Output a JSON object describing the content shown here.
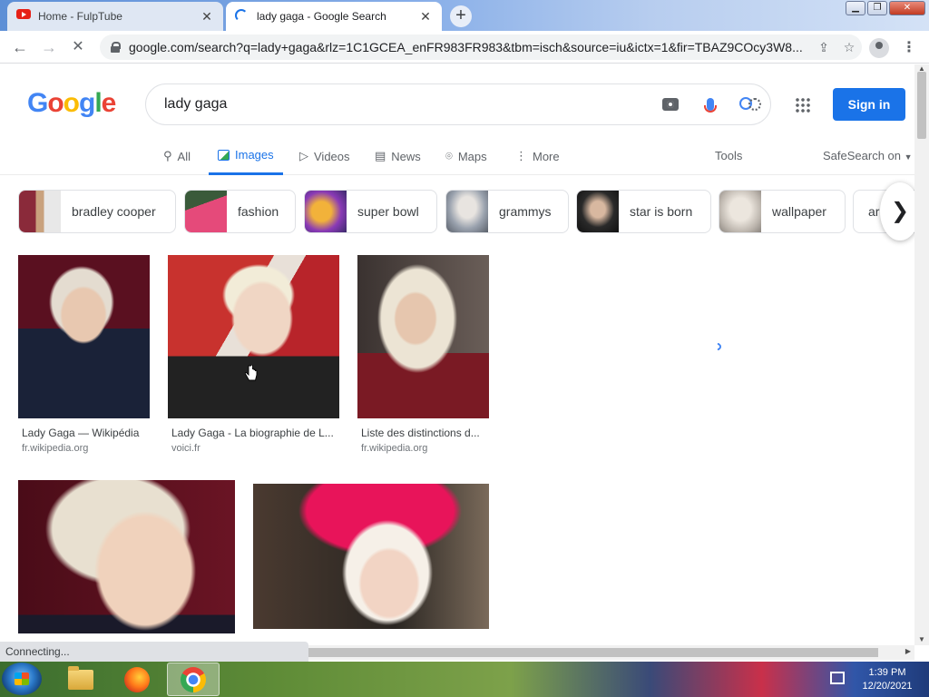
{
  "browser": {
    "tabs": [
      {
        "title": "Home - FulpTube",
        "favicon": "youtube-icon",
        "active": false
      },
      {
        "title": "lady gaga - Google Search",
        "favicon": "loading-spinner-icon",
        "active": true
      }
    ],
    "new_tab_symbol": "+",
    "url": "google.com/search?q=lady+gaga&rlz=1C1GCEA_enFR983FR983&tbm=isch&source=iu&ictx=1&fir=TBAZ9COcy3W8..."
  },
  "google": {
    "logo_letters": [
      "G",
      "o",
      "o",
      "g",
      "l",
      "e"
    ],
    "query": "lady gaga",
    "sign_in_label": "Sign in",
    "tabs": [
      {
        "label": "All",
        "icon": "search-icon"
      },
      {
        "label": "Images",
        "icon": "image-icon"
      },
      {
        "label": "Videos",
        "icon": "video-icon"
      },
      {
        "label": "News",
        "icon": "news-icon"
      },
      {
        "label": "Maps",
        "icon": "map-pin-icon"
      },
      {
        "label": "More",
        "icon": "more-vert-icon"
      }
    ],
    "tools_label": "Tools",
    "safesearch_label": "SafeSearch on",
    "chips": [
      "bradley cooper",
      "fashion",
      "super bowl",
      "grammys",
      "star is born",
      "wallpaper",
      "ar"
    ],
    "results": [
      {
        "title": "Lady Gaga — Wikipédia",
        "source": "fr.wikipedia.org"
      },
      {
        "title": "Lady Gaga - La biographie de L...",
        "source": "voici.fr"
      },
      {
        "title": "Liste des distinctions d...",
        "source": "fr.wikipedia.org"
      },
      {
        "title": "",
        "source": ""
      },
      {
        "title": "",
        "source": ""
      }
    ]
  },
  "status_text": "Connecting...",
  "taskbar": {
    "apps": [
      "folder-icon",
      "firefox-icon",
      "chrome-icon"
    ],
    "time": "1:39 PM",
    "date": "12/20/2021"
  },
  "colors": {
    "accent": "#1a73e8",
    "link_gray": "#70757a"
  }
}
